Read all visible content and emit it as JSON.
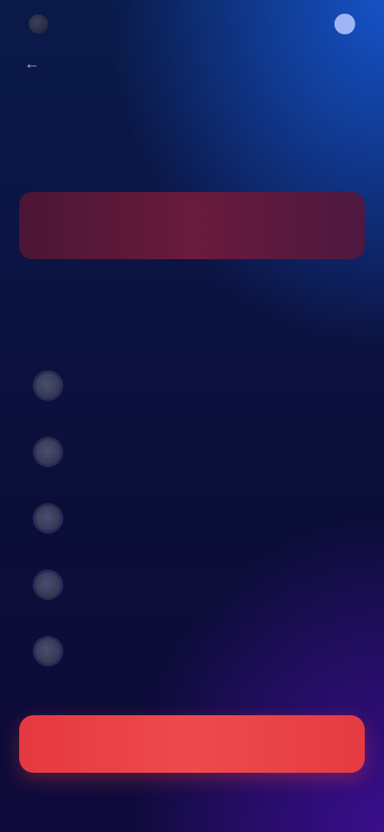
{
  "status_bar": {
    "brand": "",
    "time": ""
  },
  "top_nav": {
    "link": ""
  },
  "headline": "",
  "alert": "",
  "subhead": "",
  "section_label": "",
  "options": [
    {
      "label": ""
    },
    {
      "label": ""
    },
    {
      "label": ""
    },
    {
      "label": ""
    },
    {
      "label": ""
    }
  ],
  "primary_button": "",
  "colors": {
    "accent_teal": "#2fd0d8",
    "alert_bg": "#6a1b3c",
    "primary_button": "#e5393f",
    "bg_top": "#1552c6",
    "bg_bottom": "#3a0e8c"
  },
  "icons": {
    "brand": "brand-logo-icon",
    "back": "back-arrow-icon",
    "status": "status-dot-icon",
    "option": "radio-icon"
  }
}
